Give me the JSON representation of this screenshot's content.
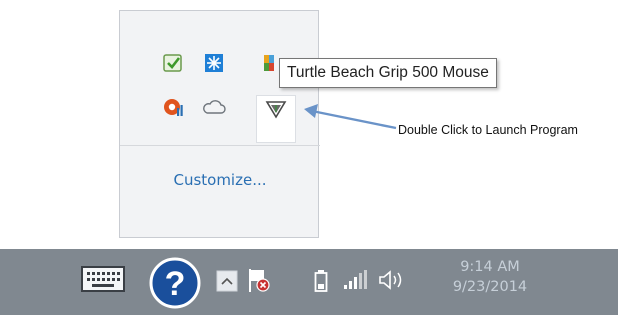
{
  "tray_popup": {
    "icons": [
      "checkbox-app-icon",
      "snowflake-app-icon",
      "colorful-app-icon",
      "orange-app-icon",
      "onedrive-cloud-icon",
      "turtle-beach-mouse-icon"
    ],
    "customize_label": "Customize..."
  },
  "tooltip": {
    "text": "Turtle Beach Grip 500 Mouse"
  },
  "annotation": {
    "text": "Double Click to Launch Program"
  },
  "taskbar": {
    "icons": [
      "keyboard-icon",
      "help-icon",
      "show-hidden-icons-icon",
      "action-center-flag-icon",
      "battery-icon",
      "network-icon",
      "volume-icon"
    ],
    "time": "9:14 AM",
    "date": "9/23/2014"
  },
  "colors": {
    "accent_link": "#2a6fb3",
    "taskbar_bg": "#808890",
    "arrow": "#6a93c8"
  }
}
